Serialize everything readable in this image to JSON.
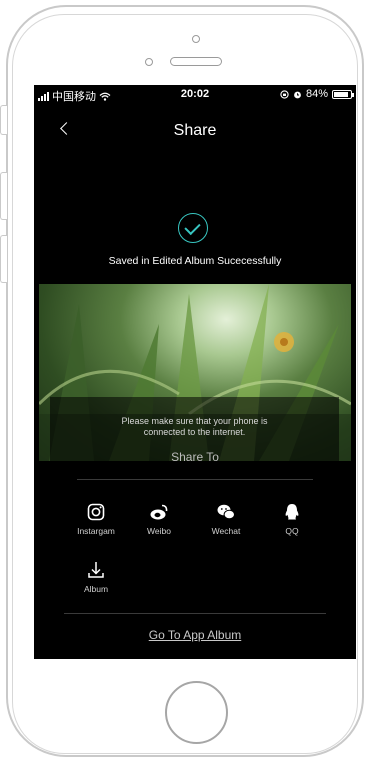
{
  "status_bar": {
    "carrier": "中国移动",
    "time": "20:02",
    "battery_percent": "84%"
  },
  "nav": {
    "title": "Share"
  },
  "success": {
    "message": "Saved in Edited Album Sucecessfully"
  },
  "preview": {
    "note_line1": "Please make sure that your phone is",
    "note_line2": "connected to the internet.",
    "share_to": "Share To"
  },
  "share_options": [
    {
      "label": "Instargam",
      "icon": "instagram-icon"
    },
    {
      "label": "Weibo",
      "icon": "weibo-icon"
    },
    {
      "label": "Wechat",
      "icon": "wechat-icon"
    },
    {
      "label": "QQ",
      "icon": "qq-icon"
    },
    {
      "label": "Album",
      "icon": "download-icon"
    }
  ],
  "footer": {
    "go_album": "Go To App Album"
  },
  "colors": {
    "accent": "#38c6c1",
    "background": "#000000"
  }
}
